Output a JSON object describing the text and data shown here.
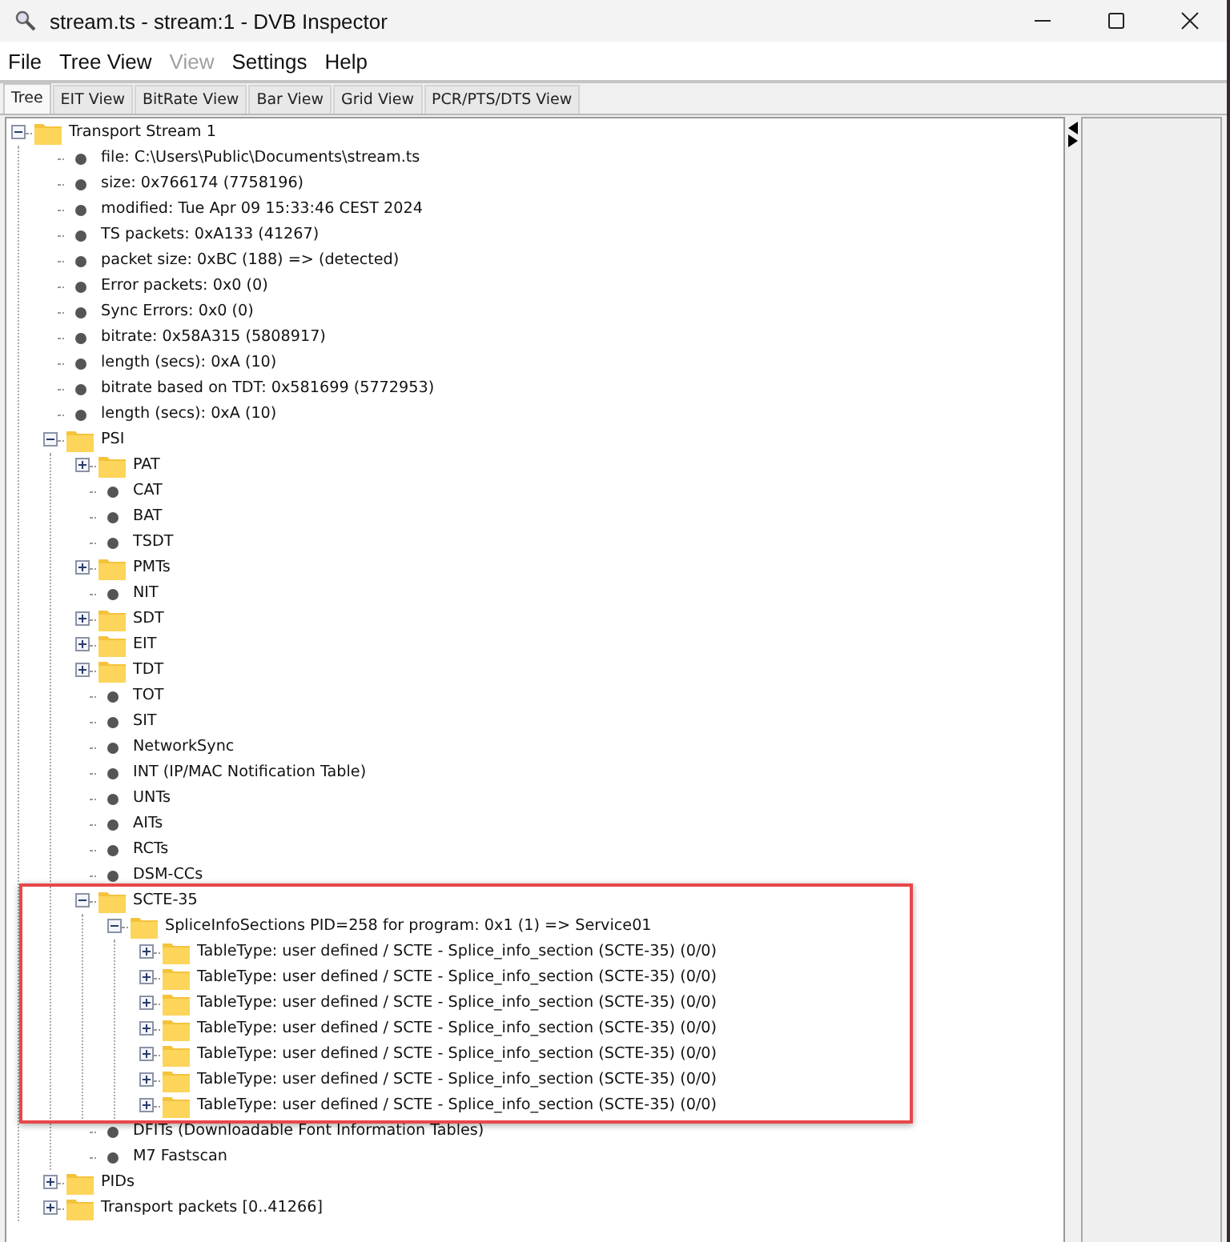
{
  "window": {
    "title": "stream.ts - stream:1 - DVB Inspector"
  },
  "menu": [
    {
      "label": "File",
      "disabled": false
    },
    {
      "label": "Tree View",
      "disabled": false
    },
    {
      "label": "View",
      "disabled": true
    },
    {
      "label": "Settings",
      "disabled": false
    },
    {
      "label": "Help",
      "disabled": false
    }
  ],
  "tabs": [
    {
      "label": "Tree",
      "selected": true
    },
    {
      "label": "EIT View",
      "selected": false
    },
    {
      "label": "BitRate View",
      "selected": false
    },
    {
      "label": "Bar View",
      "selected": false
    },
    {
      "label": "Grid View",
      "selected": false
    },
    {
      "label": "PCR/PTS/DTS View",
      "selected": false
    }
  ],
  "tree": {
    "kind": "folder",
    "label": "Transport Stream 1",
    "expanded": true,
    "children": [
      {
        "kind": "leaf",
        "label": "file: C:\\Users\\Public\\Documents\\stream.ts"
      },
      {
        "kind": "leaf",
        "label": "size: 0x766174 (7758196)"
      },
      {
        "kind": "leaf",
        "label": "modified: Tue Apr 09 15:33:46 CEST 2024"
      },
      {
        "kind": "leaf",
        "label": "TS packets: 0xA133 (41267)"
      },
      {
        "kind": "leaf",
        "label": "packet size: 0xBC (188) => (detected)"
      },
      {
        "kind": "leaf",
        "label": "Error packets: 0x0 (0)"
      },
      {
        "kind": "leaf",
        "label": "Sync Errors: 0x0 (0)"
      },
      {
        "kind": "leaf",
        "label": "bitrate: 0x58A315 (5808917)"
      },
      {
        "kind": "leaf",
        "label": "length (secs): 0xA (10)"
      },
      {
        "kind": "leaf",
        "label": "bitrate based on TDT: 0x581699 (5772953)"
      },
      {
        "kind": "leaf",
        "label": "length (secs): 0xA (10)"
      },
      {
        "kind": "folder",
        "label": "PSI",
        "expanded": true,
        "children": [
          {
            "kind": "folder",
            "label": "PAT",
            "expanded": false
          },
          {
            "kind": "leaf",
            "label": "CAT"
          },
          {
            "kind": "leaf",
            "label": "BAT"
          },
          {
            "kind": "leaf",
            "label": "TSDT"
          },
          {
            "kind": "folder",
            "label": "PMTs",
            "expanded": false
          },
          {
            "kind": "leaf",
            "label": "NIT"
          },
          {
            "kind": "folder",
            "label": "SDT",
            "expanded": false
          },
          {
            "kind": "folder",
            "label": "EIT",
            "expanded": false
          },
          {
            "kind": "folder",
            "label": "TDT",
            "expanded": false
          },
          {
            "kind": "leaf",
            "label": "TOT"
          },
          {
            "kind": "leaf",
            "label": "SIT"
          },
          {
            "kind": "leaf",
            "label": "NetworkSync"
          },
          {
            "kind": "leaf",
            "label": "INT (IP/MAC Notification Table)"
          },
          {
            "kind": "leaf",
            "label": "UNTs"
          },
          {
            "kind": "leaf",
            "label": "AITs"
          },
          {
            "kind": "leaf",
            "label": "RCTs"
          },
          {
            "kind": "leaf",
            "label": "DSM-CCs"
          },
          {
            "kind": "folder",
            "label": "SCTE-35",
            "expanded": true,
            "children": [
              {
                "kind": "folder",
                "label": "SpliceInfoSections PID=258 for program: 0x1 (1) => Service01",
                "expanded": true,
                "children": [
                  {
                    "kind": "folder",
                    "label": "TableType: user defined / SCTE - Splice_info_section (SCTE-35) (0/0)",
                    "expanded": false
                  },
                  {
                    "kind": "folder",
                    "label": "TableType: user defined / SCTE - Splice_info_section (SCTE-35) (0/0)",
                    "expanded": false
                  },
                  {
                    "kind": "folder",
                    "label": "TableType: user defined / SCTE - Splice_info_section (SCTE-35) (0/0)",
                    "expanded": false
                  },
                  {
                    "kind": "folder",
                    "label": "TableType: user defined / SCTE - Splice_info_section (SCTE-35) (0/0)",
                    "expanded": false
                  },
                  {
                    "kind": "folder",
                    "label": "TableType: user defined / SCTE - Splice_info_section (SCTE-35) (0/0)",
                    "expanded": false
                  },
                  {
                    "kind": "folder",
                    "label": "TableType: user defined / SCTE - Splice_info_section (SCTE-35) (0/0)",
                    "expanded": false
                  },
                  {
                    "kind": "folder",
                    "label": "TableType: user defined / SCTE - Splice_info_section (SCTE-35) (0/0)",
                    "expanded": false
                  }
                ]
              }
            ]
          },
          {
            "kind": "leaf",
            "label": "DFITs (Downloadable Font Information Tables)"
          },
          {
            "kind": "leaf",
            "label": "M7 Fastscan"
          }
        ]
      },
      {
        "kind": "folder",
        "label": "PIDs",
        "expanded": false
      },
      {
        "kind": "folder",
        "label": "Transport packets [0..41266]",
        "expanded": false
      }
    ]
  }
}
